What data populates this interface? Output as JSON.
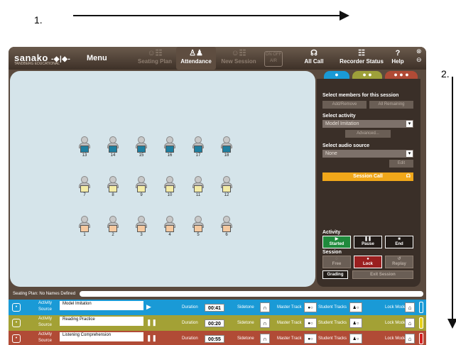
{
  "annotations": {
    "step1": "1.",
    "step2": "2."
  },
  "app": {
    "logo": "sanako",
    "logo_sub": "TANDBERG EDUCATIONAL",
    "menu": "Menu",
    "toolbar": [
      {
        "label": "Seating Plan",
        "icon": "seating-plan-icon",
        "state": "dim"
      },
      {
        "label": "Attendance",
        "icon": "attendance-icon",
        "state": "selected"
      },
      {
        "label": "New Session",
        "icon": "new-session-icon",
        "state": "dim"
      },
      {
        "label": "All Call",
        "icon": "all-call-icon",
        "state": "normal"
      },
      {
        "label": "Recorder Status",
        "icon": "recorder-status-icon",
        "state": "normal"
      },
      {
        "label": "Help",
        "icon": "help-icon",
        "state": "normal"
      }
    ],
    "on_off": "ON OFF AIR",
    "close_glyph": "⊗",
    "minimize_glyph": "⊖"
  },
  "seats": {
    "row1": [
      "13",
      "14",
      "15",
      "16",
      "17",
      "18"
    ],
    "row2": [
      "7",
      "8",
      "9",
      "10",
      "11",
      "12"
    ],
    "row3": [
      "1",
      "2",
      "3",
      "4",
      "5",
      "6"
    ],
    "row_desk_colors": [
      "#1f7fa0",
      "#f3eba6",
      "#f5c9a0"
    ]
  },
  "panel": {
    "tabs": [
      "●",
      "● ●",
      "● ● ●"
    ],
    "tab_colors": [
      "#1a9ad6",
      "#9ea03a",
      "#b14b36"
    ],
    "select_members": "Select members for this session",
    "add_remove": "Add/Remove",
    "all_remaining": "All Remaining",
    "select_activity": "Select activity",
    "activity_value": "Model Imitation",
    "advanced": "Advanced...",
    "select_audio": "Select audio source",
    "audio_value": "None",
    "edit": "Edit",
    "session_call": "Session Call",
    "activity_heading": "Activity",
    "started": "Started",
    "pause": "Pause",
    "end": "End",
    "session_heading": "Session",
    "free": "Free",
    "lock": "Lock",
    "replay": "Replay",
    "grading": "Grading",
    "exit_session": "Exit Session"
  },
  "statusbar": {
    "text": "Seating Plan:  No Names Defined"
  },
  "rows": [
    {
      "color": "#1a9ad6",
      "activity_label": "Activity",
      "source_label": "Source",
      "activity": "Model Imitation",
      "play": "▶",
      "duration_label": "Duration",
      "duration": "00:41",
      "sidetone_label": "Sidetone",
      "master_label": "Master Track",
      "student_label": "Student Tracks",
      "lock_label": "Lock Mode",
      "end_color": "#1a9ad6"
    },
    {
      "color": "#a3a135",
      "activity_label": "Activity",
      "source_label": "Source",
      "activity": "Reading Practice",
      "play": "❚❚",
      "duration_label": "Duration",
      "duration": "00:20",
      "sidetone_label": "Sidetone",
      "master_label": "Master Track",
      "student_label": "Student Tracks",
      "lock_label": "Lock Mode",
      "end_color": "#e8d21a"
    },
    {
      "color": "#b14b36",
      "activity_label": "Activity",
      "source_label": "Source",
      "activity": "Listening Comprehension",
      "play": "❚❚",
      "duration_label": "Duration",
      "duration": "00:55",
      "sidetone_label": "Sidetone",
      "master_label": "Master Track",
      "student_label": "Student Tracks",
      "lock_label": "Lock Mode",
      "end_color": "#d42020"
    }
  ]
}
